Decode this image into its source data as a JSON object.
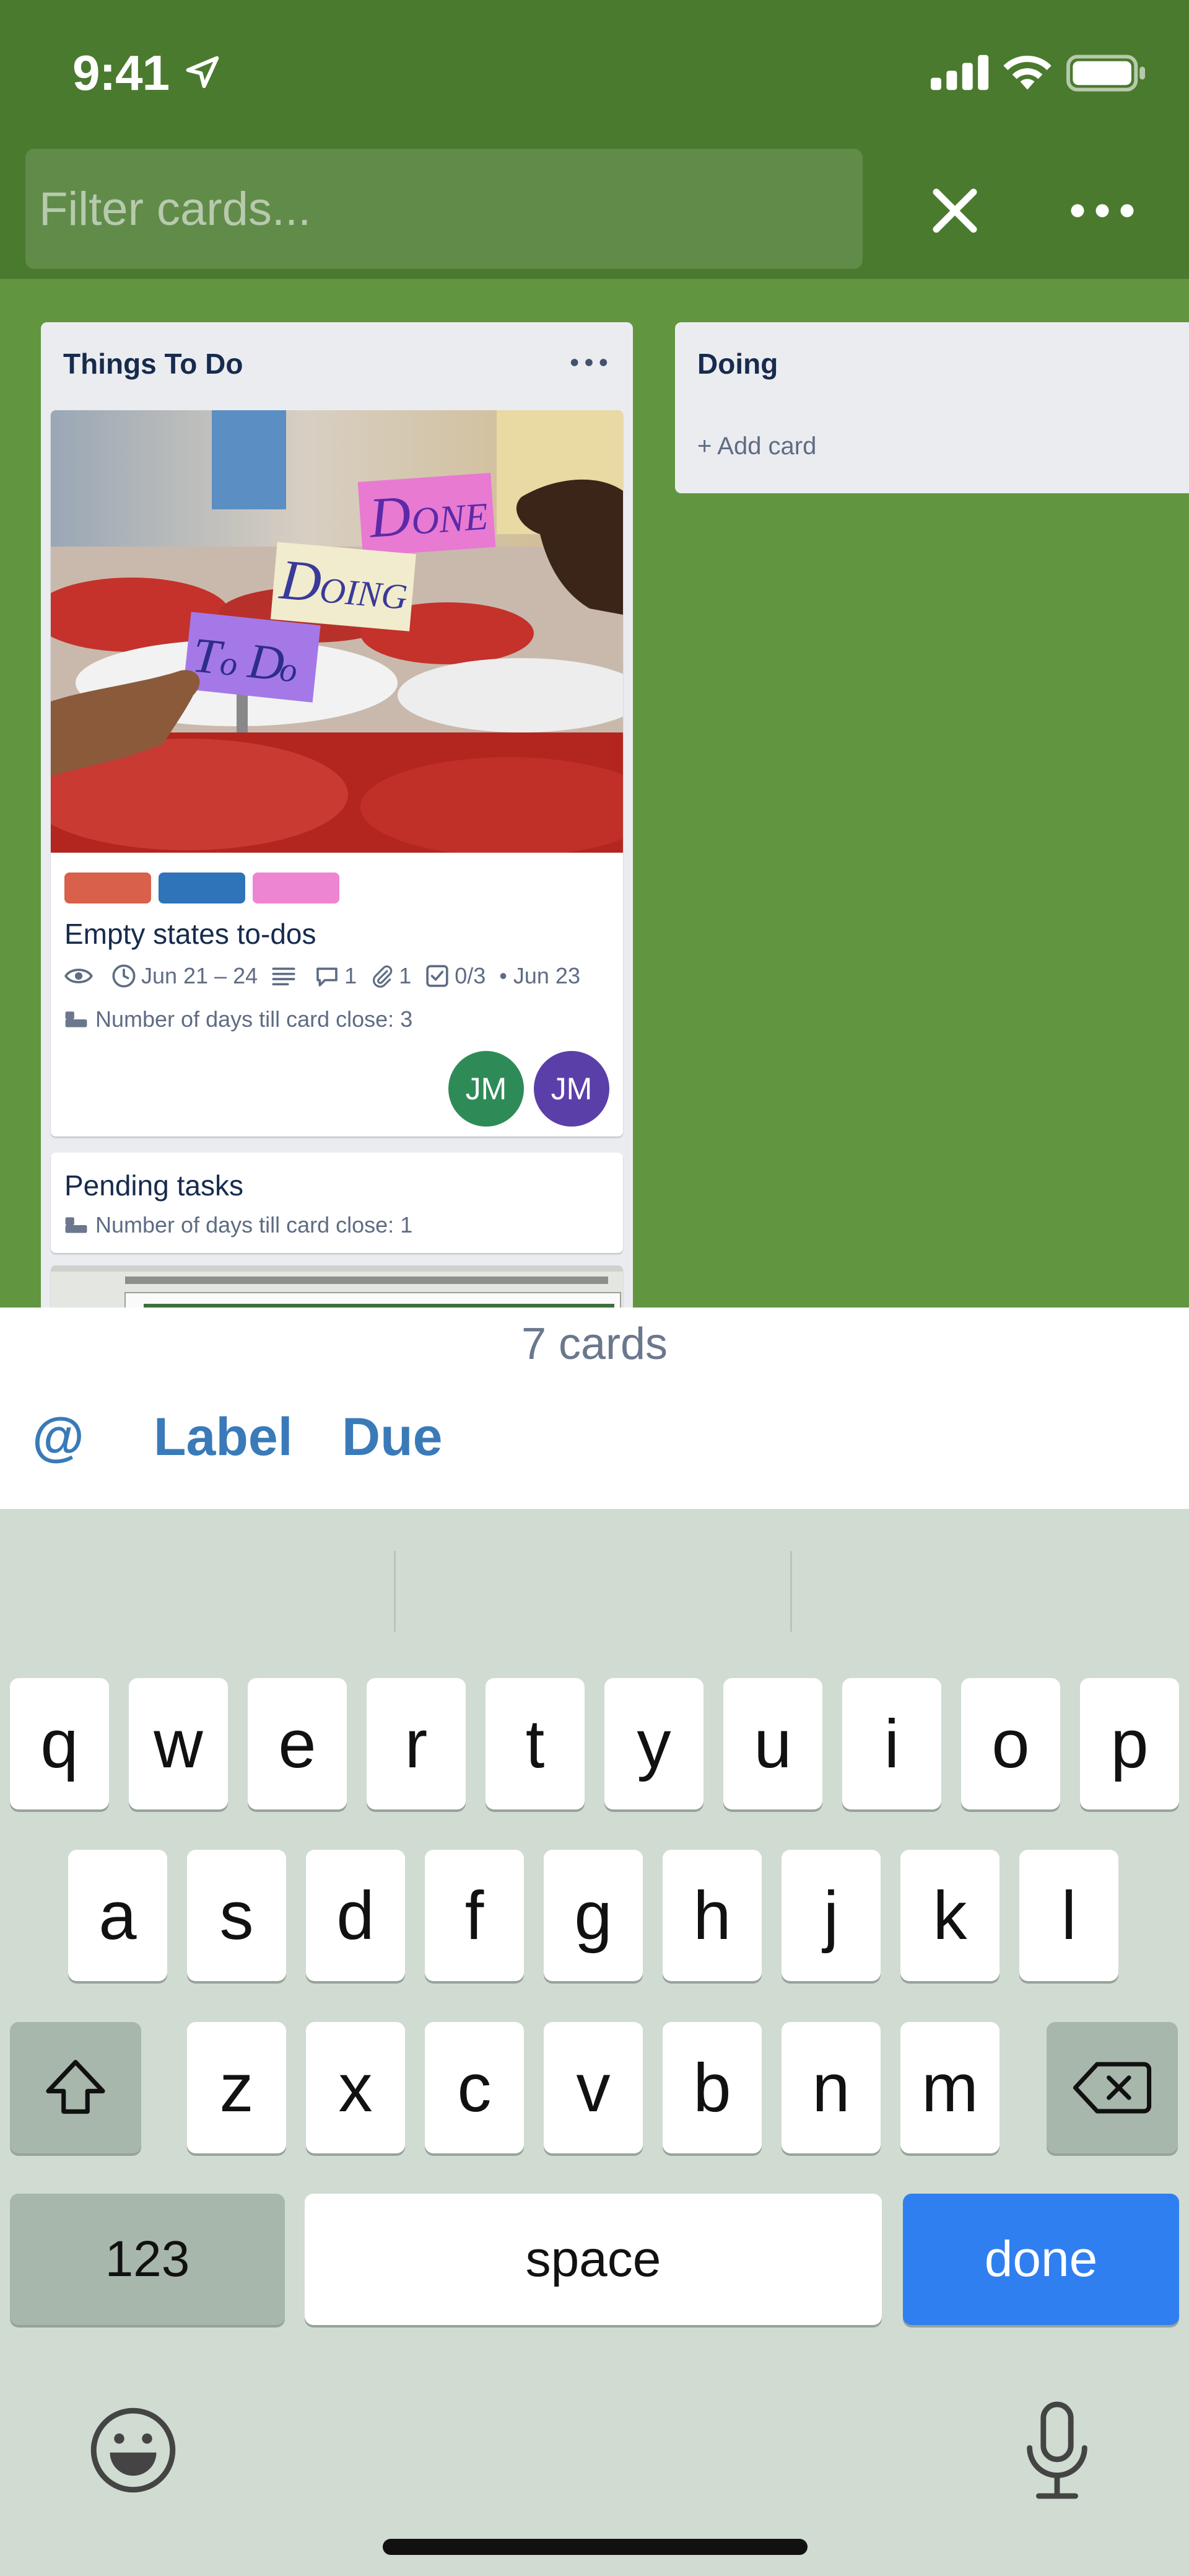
{
  "status_bar": {
    "time": "9:41"
  },
  "filter": {
    "placeholder": "Filter cards..."
  },
  "colors": {
    "topbar": "#4a7a2e",
    "board": "#62953f",
    "accent_blue": "#3a7ab8",
    "done_key": "#2f7ff0"
  },
  "lists": [
    {
      "title": "Things To Do",
      "cards": [
        {
          "cover_sticky_notes": [
            "Done",
            "Doing",
            "To Do"
          ],
          "labels": [
            "#d9604b",
            "#2f73b8",
            "#ee85d2"
          ],
          "title": "Empty states to-dos",
          "badges": {
            "watching_icon": "eye-icon",
            "dates": "Jun 21 – 24",
            "description_icon": "description-icon",
            "comments": "1",
            "attachments": "1",
            "checklist": "0/3",
            "due": "• Jun 23"
          },
          "custom_field": "Number of days till card close: 3",
          "members": [
            {
              "initials": "JM",
              "color": "#2e8b57"
            },
            {
              "initials": "JM",
              "color": "#5b3fa8"
            }
          ]
        },
        {
          "title": "Pending tasks",
          "custom_field": "Number of days till card close: 1"
        }
      ]
    },
    {
      "title": "Doing",
      "add_card": "+ Add card"
    }
  ],
  "sheet": {
    "card_count": "7 cards",
    "mention": "@",
    "label": "Label",
    "due": "Due"
  },
  "keyboard": {
    "row1": [
      "q",
      "w",
      "e",
      "r",
      "t",
      "y",
      "u",
      "i",
      "o",
      "p"
    ],
    "row2": [
      "a",
      "s",
      "d",
      "f",
      "g",
      "h",
      "j",
      "k",
      "l"
    ],
    "row3": [
      "z",
      "x",
      "c",
      "v",
      "b",
      "n",
      "m"
    ],
    "numbers": "123",
    "space": "space",
    "done": "done"
  }
}
